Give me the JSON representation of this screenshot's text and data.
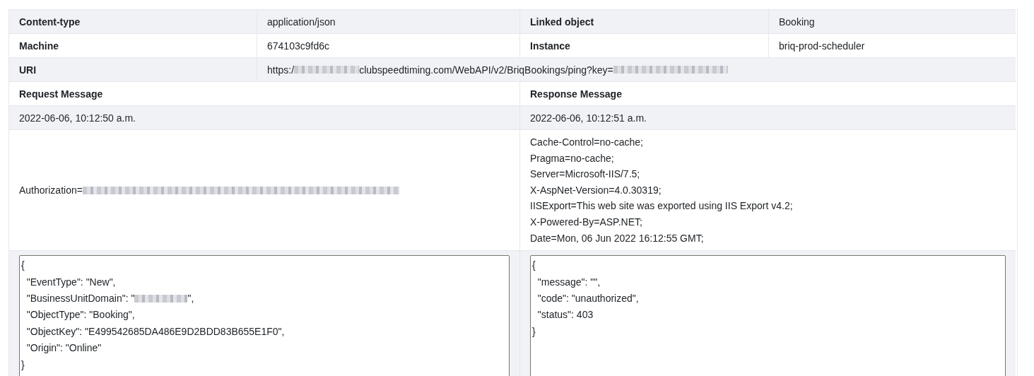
{
  "info_rows": [
    {
      "cells": [
        {
          "label": "Content-type",
          "value": "application/json"
        },
        {
          "label": "Linked object",
          "value": "Booking"
        }
      ]
    },
    {
      "cells": [
        {
          "label": "Machine",
          "value": "674103c9fd6c"
        },
        {
          "label": "Instance",
          "value": "briq-prod-scheduler"
        }
      ]
    }
  ],
  "uri": {
    "label": "URI",
    "parts": [
      {
        "kind": "text",
        "text": "https:/"
      },
      {
        "kind": "redacted"
      },
      {
        "kind": "text",
        "text": "clubspeedtiming.com/WebAPI/v2/BriqBookings/ping?key="
      },
      {
        "kind": "redacted"
      }
    ]
  },
  "request": {
    "title": "Request Message",
    "time": "2022-06-06, 10:12:50 a.m.",
    "headers": [
      [
        {
          "kind": "text",
          "text": "Authorization="
        },
        {
          "kind": "redacted"
        }
      ]
    ],
    "body": [
      [
        {
          "kind": "text",
          "text": "{"
        }
      ],
      [
        {
          "kind": "text",
          "text": "  \"EventType\": \"New\","
        }
      ],
      [
        {
          "kind": "text",
          "text": "  \"BusinessUnitDomain\": \""
        },
        {
          "kind": "redacted"
        },
        {
          "kind": "text",
          "text": "\","
        }
      ],
      [
        {
          "kind": "text",
          "text": "  \"ObjectType\": \"Booking\","
        }
      ],
      [
        {
          "kind": "text",
          "text": "  \"ObjectKey\": \"E499542685DA486E9D2BDD83B655E1F0\","
        }
      ],
      [
        {
          "kind": "text",
          "text": "  \"Origin\": \"Online\""
        }
      ],
      [
        {
          "kind": "text",
          "text": "}"
        }
      ]
    ]
  },
  "response": {
    "title": "Response Message",
    "time": "2022-06-06, 10:12:51 a.m.",
    "headers": [
      [
        {
          "kind": "text",
          "text": "Cache-Control=no-cache;"
        }
      ],
      [
        {
          "kind": "text",
          "text": "Pragma=no-cache;"
        }
      ],
      [
        {
          "kind": "text",
          "text": "Server=Microsoft-IIS/7.5;"
        }
      ],
      [
        {
          "kind": "text",
          "text": "X-AspNet-Version=4.0.30319;"
        }
      ],
      [
        {
          "kind": "text",
          "text": "IISExport=This web site was exported using IIS Export v4.2;"
        }
      ],
      [
        {
          "kind": "text",
          "text": "X-Powered-By=ASP.NET;"
        }
      ],
      [
        {
          "kind": "text",
          "text": "Date=Mon, 06 Jun 2022 16:12:55 GMT;"
        }
      ]
    ],
    "body": [
      [
        {
          "kind": "text",
          "text": "{"
        }
      ],
      [
        {
          "kind": "text",
          "text": "  \"message\": \"\","
        }
      ],
      [
        {
          "kind": "text",
          "text": "  \"code\": \"unauthorized\","
        }
      ],
      [
        {
          "kind": "text",
          "text": "  \"status\": 403"
        }
      ],
      [
        {
          "kind": "text",
          "text": "}"
        }
      ]
    ]
  }
}
